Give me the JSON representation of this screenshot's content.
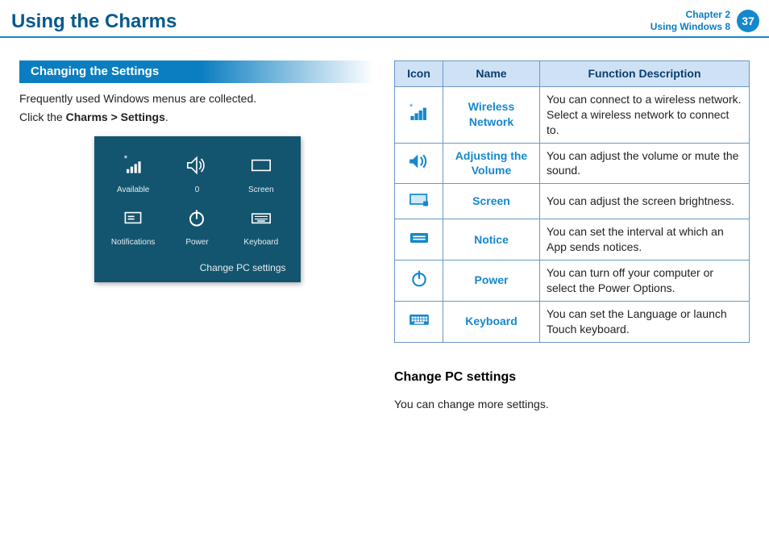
{
  "header": {
    "title": "Using the Charms",
    "chapter_line": "Chapter 2",
    "subject_line": "Using Windows 8",
    "page_number": "37"
  },
  "section_heading": "Changing the Settings",
  "intro_a": "Frequently used Windows menus are collected.",
  "intro_b_pre": "Click the ",
  "intro_b_bold": "Charms > Settings",
  "intro_b_post": ".",
  "panel": {
    "tiles": {
      "available": "Available",
      "zero": "0",
      "screen": "Screen",
      "notifications": "Notifications",
      "power": "Power",
      "keyboard": "Keyboard"
    },
    "change_pc": "Change PC settings"
  },
  "table": {
    "headers": {
      "icon": "Icon",
      "name": "Name",
      "desc": "Function Description"
    },
    "rows": [
      {
        "name": "Wireless Network",
        "desc": "You can connect to a wireless network. Select a wireless network to connect to."
      },
      {
        "name": "Adjusting the Volume",
        "desc": "You can adjust the volume or mute the sound."
      },
      {
        "name": "Screen",
        "desc": "You can adjust the screen brightness."
      },
      {
        "name": "Notice",
        "desc": "You can set the interval at which an App sends notices."
      },
      {
        "name": "Power",
        "desc": "You can turn off your computer or select the Power Options."
      },
      {
        "name": "Keyboard",
        "desc": "You can set the Language or launch Touch keyboard."
      }
    ]
  },
  "subsection": {
    "heading": "Change PC settings",
    "body": "You can change more settings."
  }
}
